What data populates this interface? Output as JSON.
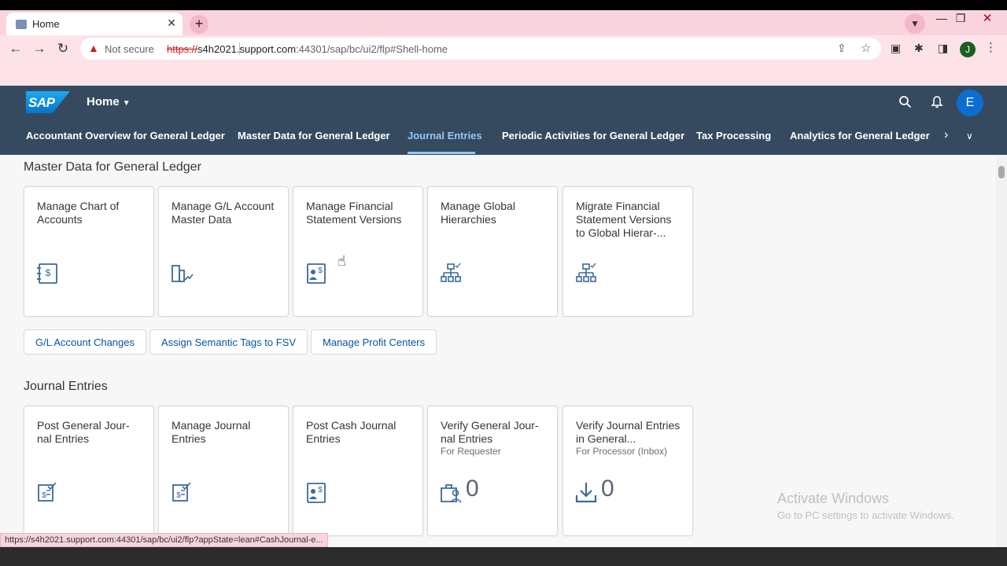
{
  "browser": {
    "tab_title": "Home",
    "tab_close": "✕",
    "new_tab": "+",
    "security_label": "Not secure",
    "url_protocol": "https://",
    "url_host": "s4h2021.support.com",
    "url_rest": ":44301/sap/bc/ui2/flp#Shell-home",
    "profile_initial": "J",
    "status_url": "https://s4h2021.support.com:44301/sap/bc/ui2/flp?appState=lean#CashJournal-e..."
  },
  "shell": {
    "logo_text": "SAP",
    "home_label": "Home",
    "avatar_initial": "E",
    "accent_color": "#0a6ed1",
    "anchor_items": [
      "Accountant Overview for General Ledger",
      "Master Data for General Ledger",
      "Journal Entries",
      "Periodic Activities for General Ledger",
      "Tax Processing",
      "Analytics for General Ledger"
    ],
    "active_anchor": "Journal Entries"
  },
  "sections": [
    {
      "title": "Master Data for General Ledger",
      "tiles": [
        {
          "title": "Manage Chart of Accounts",
          "icon": "ledger-dollar-icon"
        },
        {
          "title": "Manage G/L Account Master Data",
          "icon": "account-master-icon"
        },
        {
          "title": "Manage Financial Statement Versions",
          "icon": "financial-statement-icon"
        },
        {
          "title": "Manage Global Hierarchies",
          "icon": "hierarchy-icon"
        },
        {
          "title": "Migrate Financial Statement Versions to Global Hierar-...",
          "icon": "hierarchy-icon"
        }
      ],
      "link_tiles": [
        "G/L Account Changes",
        "Assign Semantic Tags to FSV",
        "Manage Profit Centers"
      ]
    },
    {
      "title": "Journal Entries",
      "tiles": [
        {
          "title": "Post General Jour-nal Entries",
          "subtitle": "",
          "icon": "journal-post-icon"
        },
        {
          "title": "Manage Journal Entries",
          "subtitle": "",
          "icon": "journal-post-icon"
        },
        {
          "title": "Post Cash Journal Entries",
          "subtitle": "",
          "icon": "financial-statement-icon"
        },
        {
          "title": "Verify General Jour-nal Entries",
          "subtitle": "For Requester",
          "icon": "requester-icon",
          "count": "0"
        },
        {
          "title": "Verify Journal Entries in General...",
          "subtitle": "For Processor (Inbox)",
          "icon": "inbox-download-icon",
          "count": "0"
        }
      ]
    }
  ],
  "watermark": {
    "line1": "Activate Windows",
    "line2": "Go to PC settings to activate Windows."
  }
}
